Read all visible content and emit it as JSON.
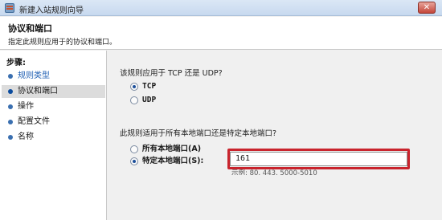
{
  "window": {
    "title": "新建入站规则向导",
    "close_glyph": "✕"
  },
  "header": {
    "title": "协议和端口",
    "subtitle": "指定此规则应用于的协议和端口。"
  },
  "steps": {
    "label": "步骤:",
    "items": [
      {
        "label": "规则类型",
        "state": "done"
      },
      {
        "label": "协议和端口",
        "state": "current"
      },
      {
        "label": "操作",
        "state": "pending"
      },
      {
        "label": "配置文件",
        "state": "pending"
      },
      {
        "label": "名称",
        "state": "pending"
      }
    ]
  },
  "protocol": {
    "question": "该规则应用于 TCP 还是 UDP?",
    "options": [
      {
        "label": "TCP",
        "checked": true
      },
      {
        "label": "UDP",
        "checked": false
      }
    ]
  },
  "ports": {
    "question": "此规则适用于所有本地端口还是特定本地端口?",
    "options": [
      {
        "label": "所有本地端口(A)",
        "checked": false
      },
      {
        "label": "特定本地端口(S):",
        "checked": true
      }
    ],
    "value": "161",
    "example": "示例: 80, 443, 5000-5010"
  },
  "colors": {
    "highlight": "#c9242d",
    "accent": "#1f5fb3"
  }
}
